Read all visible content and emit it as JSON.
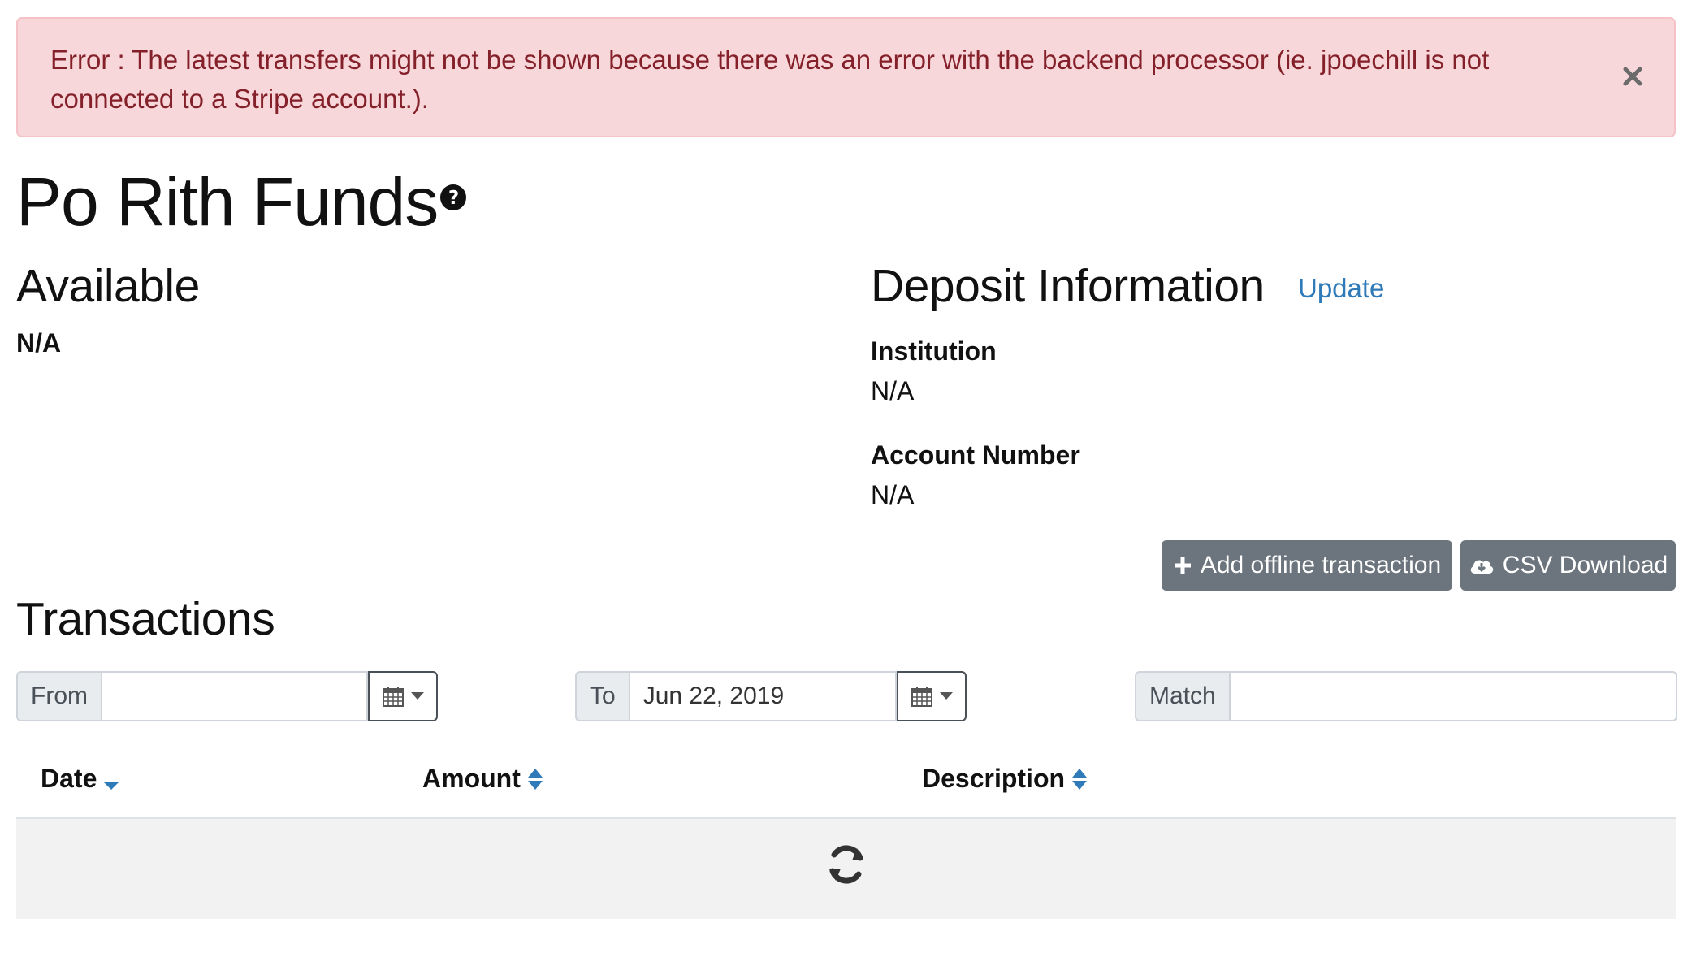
{
  "alert": {
    "text": "Error : The latest transfers might not be shown because there was an error with the backend processor (ie. jpoechill is not connected to a Stripe account.).",
    "close_icon": "close-icon"
  },
  "page": {
    "title": "Po Rith Funds",
    "help_icon": "question-circle-icon"
  },
  "available": {
    "heading": "Available",
    "value": "N/A"
  },
  "deposit": {
    "heading": "Deposit Information",
    "update_link": "Update",
    "institution_label": "Institution",
    "institution_value": "N/A",
    "account_label": "Account Number",
    "account_value": "N/A"
  },
  "actions": {
    "add_offline": "Add offline transaction",
    "csv_download": "CSV Download"
  },
  "transactions": {
    "heading": "Transactions",
    "from_label": "From",
    "from_value": "",
    "to_label": "To",
    "to_value": "Jun 22, 2019",
    "match_label": "Match",
    "match_value": "",
    "columns": [
      "Date",
      "Amount",
      "Description"
    ],
    "sort": {
      "Date": "descending",
      "Amount": "unsorted",
      "Description": "unsorted"
    }
  },
  "colors": {
    "alert_bg": "#f8d7da",
    "alert_text": "#842029",
    "link": "#2f7ab9",
    "button_bg": "#6c757d",
    "sort_arrow": "#2f7ab9"
  }
}
